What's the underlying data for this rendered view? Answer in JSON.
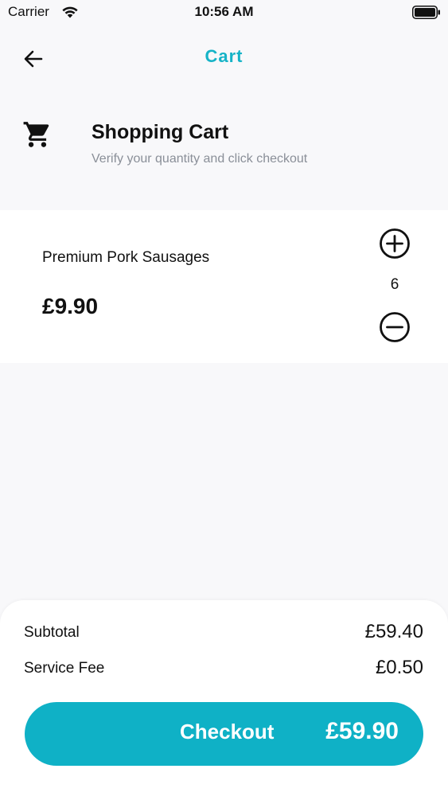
{
  "status_bar": {
    "carrier": "Carrier",
    "time": "10:56 AM"
  },
  "nav": {
    "title": "Cart",
    "back_icon": "arrow-left-icon"
  },
  "header": {
    "title": "Shopping Cart",
    "subtitle": "Verify your quantity and click checkout",
    "icon": "shopping-cart-icon"
  },
  "cart_items": [
    {
      "name": "Premium Pork Sausages",
      "price": "£9.90",
      "quantity": "6"
    }
  ],
  "summary": {
    "subtotal_label": "Subtotal",
    "subtotal_value": "£59.40",
    "fee_label": "Service Fee",
    "fee_value": "£0.50"
  },
  "checkout": {
    "label": "Checkout",
    "total": "£59.90"
  },
  "colors": {
    "accent": "#0fb1c6",
    "title_accent": "#16b3c7",
    "background": "#f8f8fa",
    "card": "#ffffff",
    "muted_text": "#8a8f98"
  }
}
